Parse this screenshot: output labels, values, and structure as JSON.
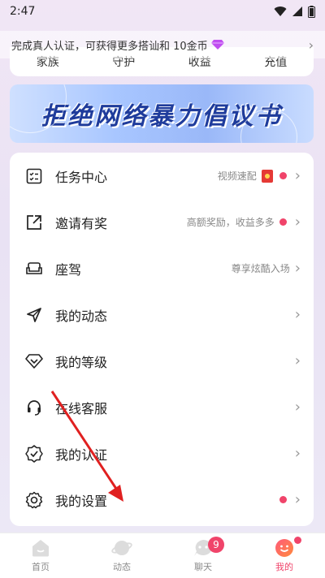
{
  "status": {
    "time": "2:47"
  },
  "verify_banner": {
    "text": "完成真人认证，可获得更多搭讪和 10金币"
  },
  "stats": [
    "家族",
    "守护",
    "收益",
    "充值"
  ],
  "banner": {
    "title": "拒绝网络暴力倡议书"
  },
  "menu": [
    {
      "icon": "task-list-icon",
      "label": "任务中心",
      "hint": "视频速配",
      "red_packet": true,
      "dot": true
    },
    {
      "icon": "share-icon",
      "label": "邀请有奖",
      "hint": "高额奖励，收益多多",
      "red_packet": false,
      "dot": true
    },
    {
      "icon": "sofa-icon",
      "label": "座驾",
      "hint": "尊享炫酷入场",
      "red_packet": false,
      "dot": false
    },
    {
      "icon": "send-icon",
      "label": "我的动态",
      "hint": "",
      "red_packet": false,
      "dot": false
    },
    {
      "icon": "diamond-heart-icon",
      "label": "我的等级",
      "hint": "",
      "red_packet": false,
      "dot": false
    },
    {
      "icon": "headset-icon",
      "label": "在线客服",
      "hint": "",
      "red_packet": false,
      "dot": false
    },
    {
      "icon": "verified-badge-icon",
      "label": "我的认证",
      "hint": "",
      "red_packet": false,
      "dot": false
    },
    {
      "icon": "settings-gear-icon",
      "label": "我的设置",
      "hint": "",
      "red_packet": false,
      "dot": true
    }
  ],
  "tabs": [
    {
      "label": "首页",
      "icon": "home-icon",
      "active": false,
      "badge": ""
    },
    {
      "label": "动态",
      "icon": "planet-icon",
      "active": false,
      "badge": ""
    },
    {
      "label": "聊天",
      "icon": "chat-icon",
      "active": false,
      "badge": "9"
    },
    {
      "label": "我的",
      "icon": "profile-face-icon",
      "active": true,
      "badge": ""
    }
  ],
  "colors": {
    "accent": "#f0446a",
    "banner_text": "#1f3c9c",
    "annotation_arrow": "#e02020"
  }
}
